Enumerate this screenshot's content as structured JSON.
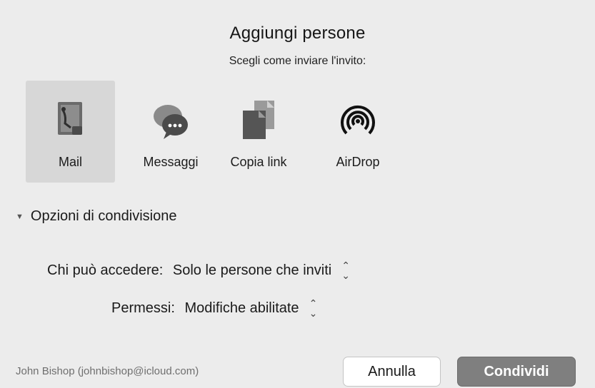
{
  "dialog": {
    "title": "Aggiungi persone",
    "subtitle": "Scegli come inviare l'invito:"
  },
  "share_methods": [
    {
      "label": "Mail",
      "icon": "mail-icon",
      "selected": true
    },
    {
      "label": "Messaggi",
      "icon": "messages-icon",
      "selected": false
    },
    {
      "label": "Copia link",
      "icon": "copy-link-icon",
      "selected": false
    },
    {
      "label": "AirDrop",
      "icon": "airdrop-icon",
      "selected": false
    }
  ],
  "options": {
    "disclosure_label": "Opzioni di condivisione",
    "disclosure_state": "expanded",
    "access_label": "Chi può accedere:",
    "access_value": "Solo le persone che inviti",
    "permissions_label": "Permessi:",
    "permissions_value": "Modifiche abilitate"
  },
  "footer": {
    "account": "John Bishop (johnbishop@icloud.com)",
    "cancel_label": "Annulla",
    "share_label": "Condividi"
  },
  "colors": {
    "background": "#ececec",
    "primary_button": "#7f7f7f",
    "selected_tile": "#d7d7d7"
  }
}
